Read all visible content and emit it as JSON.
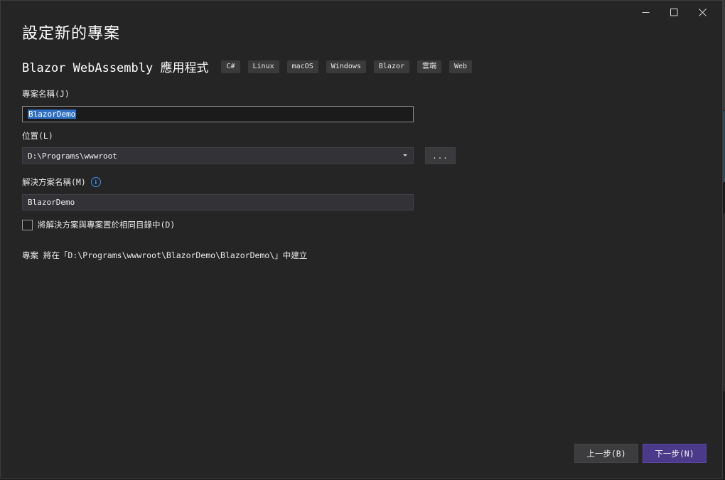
{
  "window": {
    "controls": [
      "minimize-icon",
      "maximize-icon",
      "close-icon"
    ]
  },
  "dialog": {
    "title": "設定新的專案",
    "template_name": "Blazor WebAssembly 應用程式",
    "tags": [
      "C#",
      "Linux",
      "macOS",
      "Windows",
      "Blazor",
      "雲端",
      "Web"
    ]
  },
  "project_name": {
    "label": "專案名稱(J)",
    "value": "BlazorDemo"
  },
  "location": {
    "label": "位置(L)",
    "value": "D:\\Programs\\wwwroot",
    "browse_label": "..."
  },
  "solution_name": {
    "label": "解決方案名稱(M)",
    "value": "BlazorDemo"
  },
  "same_directory": {
    "label": "將解決方案與專案置於相同目錄中(D)",
    "checked": false
  },
  "path_note": "專案 將在「D:\\Programs\\wwwroot\\BlazorDemo\\BlazorDemo\\」中建立",
  "footer": {
    "back_label": "上一步(B)",
    "next_label": "下一步(N)"
  },
  "colors": {
    "background": "#252526",
    "accent_next": "#4b3a8a",
    "selection": "#2f6fc4",
    "info": "#3794ff"
  }
}
